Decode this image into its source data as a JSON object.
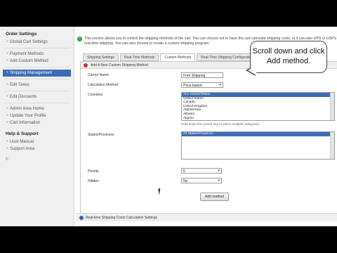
{
  "sidebar": {
    "heading_order": "Order Settings",
    "items_order": [
      "Global Cart Settings",
      "Payment Methods",
      "Add Custom Method"
    ],
    "active_item": "Shipping Management",
    "items_tax": [
      "Edit Taxes",
      "Edit Discounts"
    ],
    "items_admin": [
      "Admin Area Home",
      "Update Your Profile",
      "Cart Information"
    ],
    "heading_help": "Help & Support",
    "items_help": [
      "User Manual",
      "Support Area"
    ],
    "badge": "©"
  },
  "info_text": "This section allows you to control the shipping methods of the cart. You can choose not to have the cart calculate shipping costs, or it can also UPS or USPS real-time shipping. You can also choose to create a custom shipping program.",
  "tabs": [
    "Shipping Settings",
    "Real-Time Methods",
    "Custom Methods",
    "Real-Time Shipping Configurations"
  ],
  "panel_title": "Add A New Custom Shipping Method",
  "form": {
    "carrier_label": "Carrier Name",
    "carrier_value": "Free Shipping",
    "calc_label": "Calculation Method",
    "calc_value": "Price-based",
    "countries_label": "Countries",
    "countries": [
      "ALL COUNTRIES",
      "United States",
      "Canada",
      "United Kingdom",
      "Afghanistan",
      "Albania",
      "Algeria"
    ],
    "countries_hint": "Hold down the control key to select multiple categories.",
    "states_label": "States/Provinces",
    "states": [
      "All States/Provinces"
    ],
    "priority_label": "Priority",
    "priority_value": "5",
    "hidden_label": "Hidden",
    "hidden_value": "No",
    "add_button": "Add method"
  },
  "footer_title": "Real-time Shipping Costs Calculation Settings",
  "callout_text": "Scroll down and click Add method."
}
